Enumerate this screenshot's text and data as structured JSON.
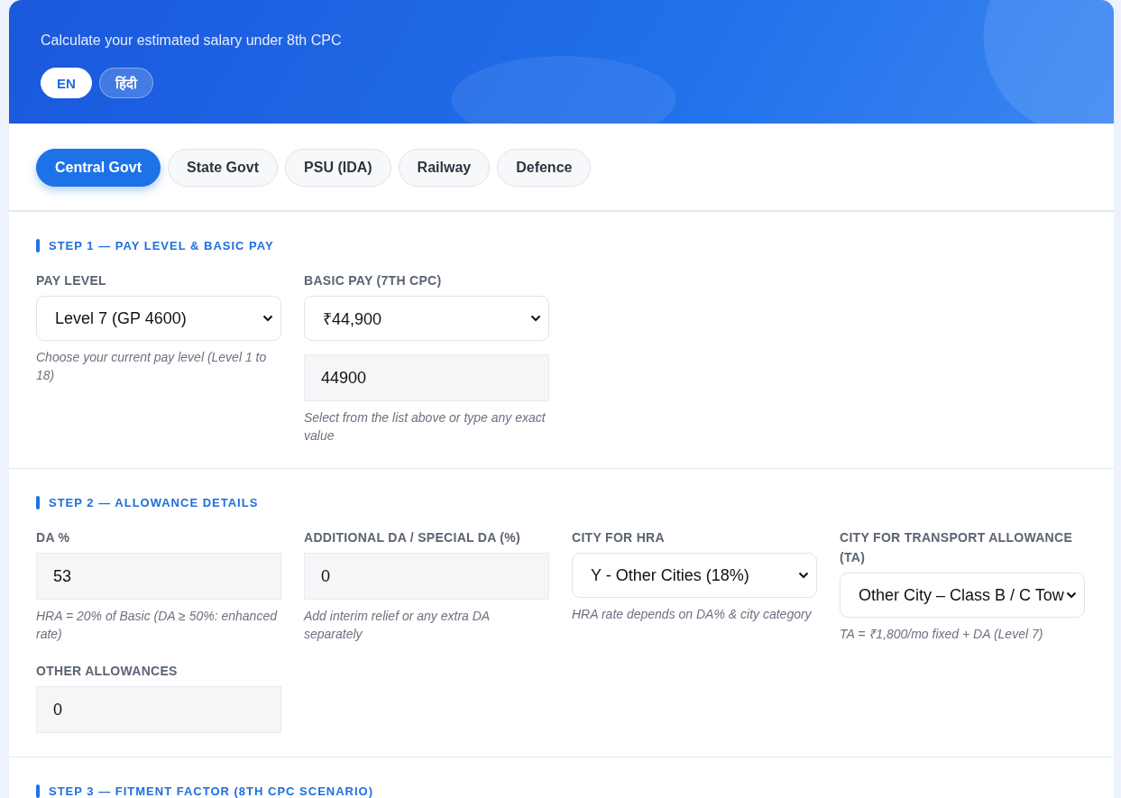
{
  "header": {
    "subtitle": "Calculate your estimated salary under 8th CPC",
    "languages": [
      {
        "label": "EN",
        "selected": true
      },
      {
        "label": "हिंदी",
        "selected": false
      }
    ]
  },
  "tabs": [
    {
      "label": "Central Govt",
      "selected": true
    },
    {
      "label": "State Govt",
      "selected": false
    },
    {
      "label": "PSU (IDA)",
      "selected": false
    },
    {
      "label": "Railway",
      "selected": false
    },
    {
      "label": "Defence",
      "selected": false
    }
  ],
  "steps": [
    {
      "title": "STEP 1 — PAY LEVEL & BASIC PAY",
      "fields": [
        {
          "label": "PAY LEVEL",
          "controls": [
            {
              "kind": "select",
              "value": "Level 7  (GP 4600)"
            }
          ],
          "hint": "Choose your current pay level (Level 1 to 18)"
        },
        {
          "label": "BASIC PAY (7TH CPC)",
          "controls": [
            {
              "kind": "select",
              "value": "₹44,900"
            },
            {
              "kind": "input",
              "value": "44900"
            }
          ],
          "hint": "Select from the list above or type any exact value"
        }
      ]
    },
    {
      "title": "STEP 2 — ALLOWANCE DETAILS",
      "fields": [
        {
          "label": "DA %",
          "controls": [
            {
              "kind": "input",
              "value": "53"
            }
          ],
          "hint": "HRA = 20% of Basic (DA ≥ 50%: enhanced rate)"
        },
        {
          "label": "ADDITIONAL DA / SPECIAL DA (%)",
          "controls": [
            {
              "kind": "input",
              "value": "0"
            }
          ],
          "hint": "Add interim relief or any extra DA separately"
        },
        {
          "label": "CITY FOR HRA",
          "controls": [
            {
              "kind": "select",
              "value": "Y - Other Cities (18%)"
            }
          ],
          "hint": "HRA rate depends on DA% & city category"
        },
        {
          "label": "CITY FOR TRANSPORT ALLOWANCE (TA)",
          "controls": [
            {
              "kind": "select",
              "value": "Other City – Class B / C Tow"
            }
          ],
          "hint": "TA = ₹1,800/mo fixed + DA (Level 7)"
        },
        {
          "label": "OTHER ALLOWANCES",
          "controls": [
            {
              "kind": "input",
              "value": "0"
            }
          ]
        }
      ]
    },
    {
      "title": "STEP 3 — FITMENT FACTOR (8TH CPC SCENARIO)"
    }
  ]
}
